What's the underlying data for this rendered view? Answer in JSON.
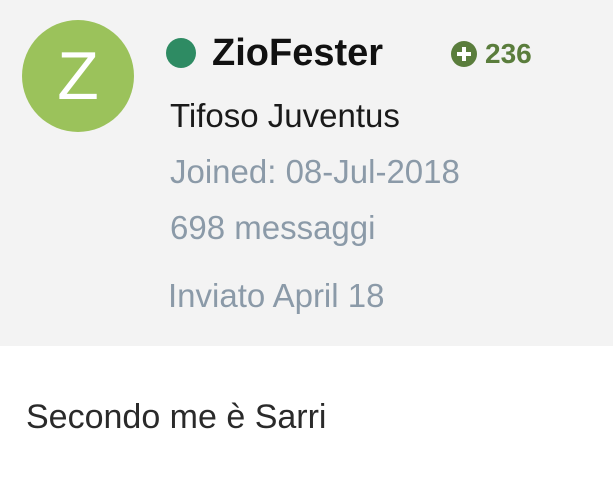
{
  "author": {
    "avatar_letter": "Z",
    "avatar_color": "#9bc25b",
    "online_color": "#2e8b63",
    "username": "ZioFester",
    "reputation": "236",
    "reputation_icon": "plus-circle-icon",
    "title": "Tifoso Juventus",
    "joined": "Joined: 08-Jul-2018",
    "messages": "698 messaggi"
  },
  "post": {
    "date": "Inviato April 18",
    "body": "Secondo me è Sarri"
  }
}
